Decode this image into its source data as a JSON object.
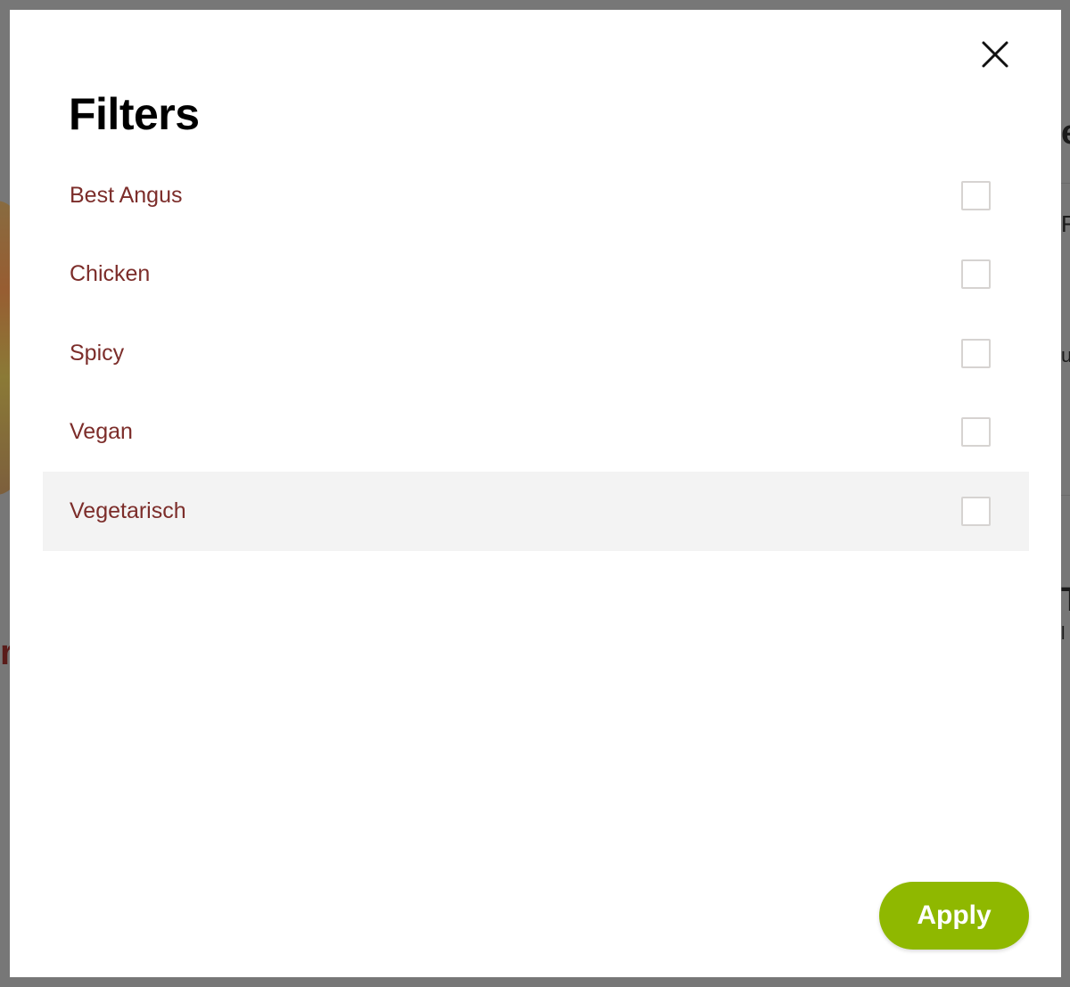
{
  "modal": {
    "title": "Filters",
    "close_icon": "close-icon",
    "filters": [
      {
        "label": "Best Angus",
        "checked": false
      },
      {
        "label": "Chicken",
        "checked": false
      },
      {
        "label": "Spicy",
        "checked": false
      },
      {
        "label": "Vegan",
        "checked": false
      },
      {
        "label": "Vegetarisch",
        "checked": false
      }
    ],
    "apply_label": "Apply"
  },
  "colors": {
    "overlay": "#777777",
    "label": "#7c2d2a",
    "apply": "#8fb800",
    "hover_row": "#f3f3f3"
  }
}
